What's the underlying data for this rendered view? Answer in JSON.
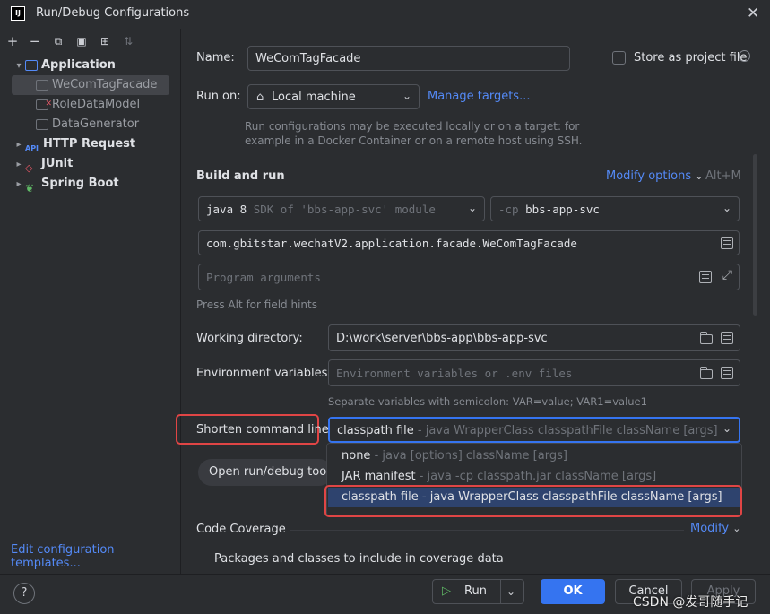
{
  "window": {
    "title": "Run/Debug Configurations",
    "logo_text": "IJ"
  },
  "tree": {
    "root_label": "Application",
    "children": [
      "WeComTagFacade",
      "RoleDataModel",
      "DataGenerator"
    ],
    "groups": [
      "HTTP Request",
      "JUnit",
      "Spring Boot"
    ],
    "edit_templates": "Edit configuration templates..."
  },
  "form": {
    "name_label": "Name:",
    "name_value": "WeComTagFacade",
    "store_label": "Store as project file",
    "run_on_label": "Run on:",
    "run_on_value": "Local machine",
    "manage_targets": "Manage targets...",
    "run_on_hint_1": "Run configurations may be executed locally or on a target: for",
    "run_on_hint_2": "example in a Docker Container or on a remote host using SSH.",
    "build_title": "Build and run",
    "modify_options": "Modify options",
    "modify_shortcut": "Alt+M",
    "jdk_value": "java 8",
    "jdk_hint": "SDK of 'bbs-app-svc' module",
    "cp_prefix": "-cp",
    "cp_value": "bbs-app-svc",
    "main_class": "com.gbitstar.wechatV2.application.facade.WeComTagFacade",
    "program_args_placeholder": "Program arguments",
    "field_hints": "Press Alt for field hints",
    "workdir_label": "Working directory:",
    "workdir_value": "D:\\work\\server\\bbs-app\\bbs-app-svc",
    "env_label": "Environment variables:",
    "env_placeholder": "Environment variables or .env files",
    "env_hint": "Separate variables with semicolon: VAR=value; VAR1=value1",
    "shorten_label": "Shorten command line:",
    "shorten_value": "classpath file",
    "shorten_value_hint": "- java WrapperClass classpathFile className [args]",
    "open_tool_label": "Open run/debug tool",
    "coverage_title": "Code Coverage",
    "coverage_modify": "Modify",
    "coverage_packages": "Packages and classes to include in coverage data"
  },
  "popup": {
    "options": [
      {
        "name": "none",
        "hint": "- java [options] className [args]"
      },
      {
        "name": "JAR manifest",
        "hint": "- java -cp classpath.jar className [args]"
      },
      {
        "name": "classpath file",
        "hint": "- java WrapperClass classpathFile className [args]"
      }
    ]
  },
  "footer": {
    "help": "?",
    "run": "Run",
    "ok": "OK",
    "cancel": "Cancel",
    "apply": "Apply",
    "watermark": "CSDN @发哥随手记"
  },
  "colors": {
    "accent": "#3574f0",
    "link": "#548af7",
    "highlight": "#e04545",
    "selection": "#2e436e"
  }
}
